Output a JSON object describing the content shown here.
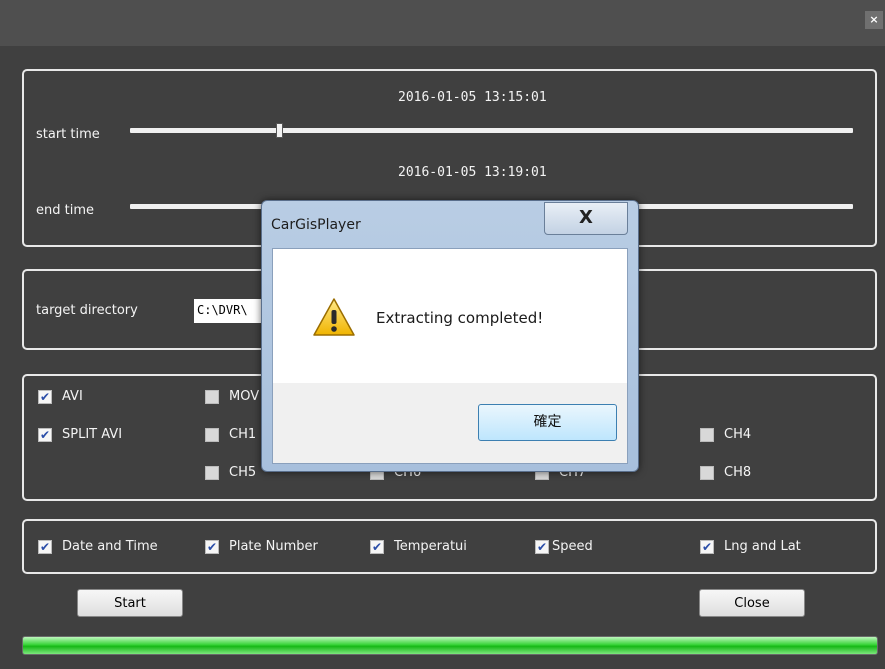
{
  "window": {
    "close_glyph": "×"
  },
  "time_group": {
    "start_label": "start time",
    "start_value": "2016-01-05 13:15:01",
    "start_fraction": 0.21,
    "end_label": "end time",
    "end_value": "2016-01-05 13:19:01",
    "end_fraction": 0.21
  },
  "dir_group": {
    "label": "target directory",
    "value": "C:\\DVR\\"
  },
  "format_group": {
    "avi": {
      "label": "AVI",
      "checked": true
    },
    "mov": {
      "label": "MOV",
      "checked": false
    },
    "split_avi": {
      "label": "SPLIT AVI",
      "checked": true
    },
    "channels": [
      {
        "label": "CH1",
        "checked": false
      },
      {
        "label": "CH4",
        "checked": false
      },
      {
        "label": "CH5",
        "checked": false
      },
      {
        "label": "CH6",
        "checked": false
      },
      {
        "label": "CH7",
        "checked": false
      },
      {
        "label": "CH8",
        "checked": false
      }
    ]
  },
  "overlay_group": {
    "items": [
      {
        "label": "Date and Time",
        "checked": true
      },
      {
        "label": "Plate Number",
        "checked": true
      },
      {
        "label": "Temperatui",
        "checked": true
      },
      {
        "label": "Speed",
        "checked": true
      },
      {
        "label": "Lng and Lat",
        "checked": true
      }
    ]
  },
  "buttons": {
    "start": "Start",
    "close": "Close"
  },
  "progress": {
    "fraction": 1.0,
    "color": "#22c822"
  },
  "dialog": {
    "title": "CarGisPlayer",
    "close_glyph": "X",
    "icon": "warning-icon",
    "message": "Extracting completed!",
    "ok_label": "確定"
  }
}
